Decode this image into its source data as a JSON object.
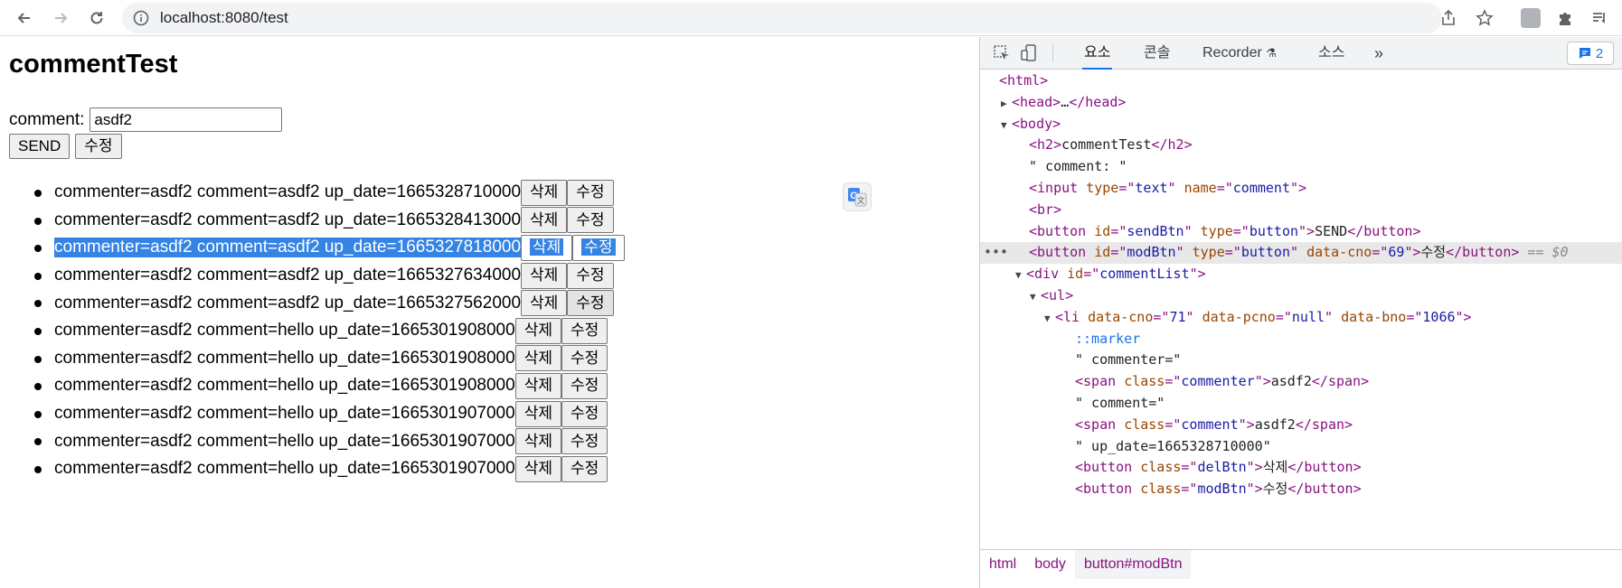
{
  "browser": {
    "url": "localhost:8080/test"
  },
  "page": {
    "title": "commentTest",
    "comment_label": "comment:",
    "comment_value": "asdf2",
    "send_label": "SEND",
    "modify_label": "수정",
    "delete_btn_label": "삭제",
    "modify_btn_label": "수정",
    "comments": [
      "commenter=asdf2 comment=asdf2 up_date=1665328710000",
      "commenter=asdf2 comment=asdf2 up_date=1665328413000",
      "commenter=asdf2 comment=asdf2 up_date=1665327818000",
      "commenter=asdf2 comment=asdf2 up_date=1665327634000",
      "commenter=asdf2 comment=asdf2 up_date=1665327562000",
      "commenter=asdf2 comment=hello up_date=1665301908000",
      "commenter=asdf2 comment=hello up_date=1665301908000",
      "commenter=asdf2 comment=hello up_date=1665301908000",
      "commenter=asdf2 comment=hello up_date=1665301907000",
      "commenter=asdf2 comment=hello up_date=1665301907000",
      "commenter=asdf2 comment=hello up_date=1665301907000"
    ]
  },
  "devtools": {
    "tabs": [
      "요소",
      "콘솔",
      "Recorder",
      "소스"
    ],
    "badge_count": "2",
    "breadcrumbs": [
      "html",
      "body",
      "button#modBtn"
    ],
    "selected_suffix": "== $0",
    "dots": "•••"
  },
  "colors": {
    "selection": "#3584e4",
    "tag": "#881280",
    "attr": "#994500",
    "value": "#1a1aa6",
    "accent": "#1a73e8"
  }
}
